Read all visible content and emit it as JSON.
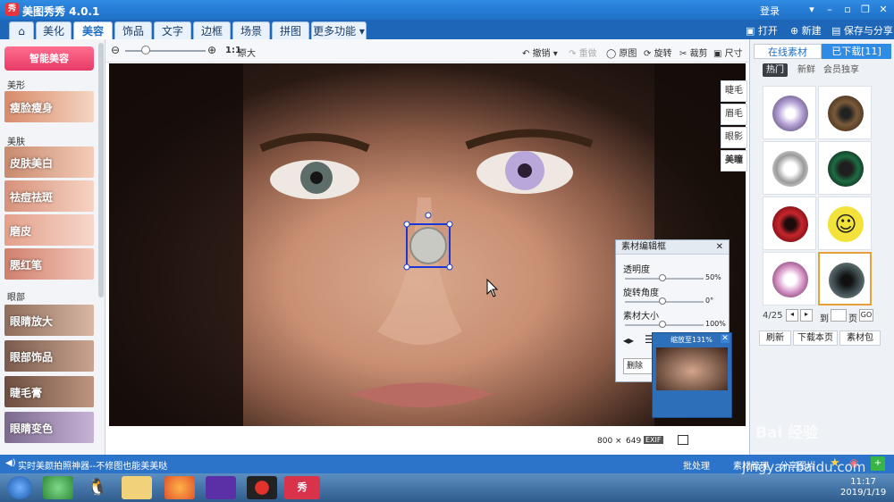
{
  "window": {
    "title": "美图秀秀 4.0.1",
    "login": "登录"
  },
  "menu": {
    "tabs": [
      "美化",
      "美容",
      "饰品",
      "文字",
      "边框",
      "场景",
      "拼图",
      "更多功能"
    ],
    "active_tab": "美容",
    "right": {
      "open": "打开",
      "new": "新建",
      "save": "保存与分享"
    }
  },
  "left_panel": {
    "smart_button": "智能美容",
    "sections": [
      {
        "label": "美形",
        "items": [
          "瘦脸瘦身"
        ]
      },
      {
        "label": "美肤",
        "items": [
          "皮肤美白",
          "祛痘祛斑",
          "磨皮",
          "腮红笔"
        ]
      },
      {
        "label": "眼部",
        "items": [
          "眼睛放大",
          "眼部饰品",
          "睫毛膏",
          "眼睛变色"
        ]
      }
    ]
  },
  "toolbar": {
    "one_to_one": "1:1",
    "original_size": "原大",
    "undo": "撤销",
    "redo": "重做",
    "original": "原图",
    "rotate": "旋转",
    "crop": "裁剪",
    "size": "尺寸"
  },
  "side_tabs": [
    "睫毛",
    "眉毛",
    "眼影",
    "美瞳"
  ],
  "editor": {
    "title": "素材编辑框",
    "rows": [
      {
        "label": "透明度",
        "value": "50%"
      },
      {
        "label": "旋转角度",
        "value": "0°"
      },
      {
        "label": "素材大小",
        "value": "100%"
      }
    ],
    "delete_label": "删除"
  },
  "preview": {
    "zoom_text": "缩放至131%"
  },
  "image_info": {
    "width": "800",
    "times": "×",
    "height": "649",
    "exif": "EXIF"
  },
  "right_panel": {
    "tab_online": "在线素材",
    "tab_downloaded": "已下载[11]",
    "subtabs": [
      "热门",
      "新鲜",
      "会员独享"
    ],
    "page_text": "4/25",
    "goto_label": "到",
    "page_label": "页",
    "go_label": "GO",
    "buttons": [
      "刷新",
      "下载本页",
      "素材包"
    ],
    "lens_colors": [
      "#b9a7d9",
      "#7a5a3a",
      "#9a9a9a",
      "#1e6d43",
      "#c6262d",
      "#f2e23a",
      "#d999c9",
      "#3d4b4f"
    ]
  },
  "status": {
    "tip": "实时美颜拍照神器--不修图也能美美哒",
    "batch": "批处理",
    "material_manage": "素材管理",
    "share": "分享图片"
  },
  "taskbar": {
    "time": "11:17",
    "date": "2019/1/19"
  },
  "watermark": {
    "line1": "Bai 经验",
    "line2": "jingyan.baidu.com"
  }
}
